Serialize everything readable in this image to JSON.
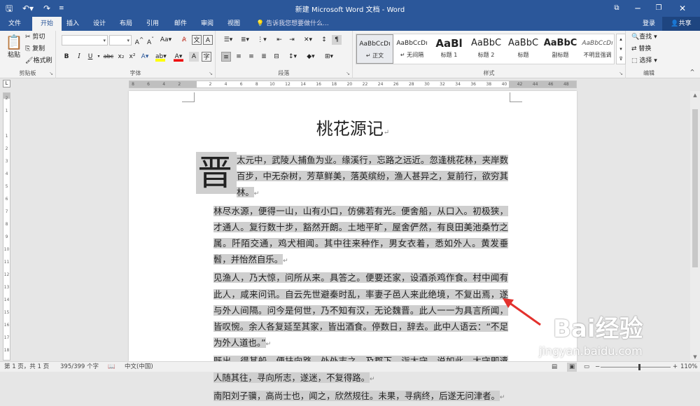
{
  "titlebar": {
    "title": "新建 Microsoft Word 文档 - Word",
    "qa_save_icon": "save-icon",
    "qa_undo_icon": "undo-icon",
    "qa_redo_icon": "redo-icon",
    "qa_customize_icon": "customize-icon"
  },
  "tabs": {
    "file": "文件",
    "home": "开始",
    "insert": "插入",
    "design": "设计",
    "layout": "布局",
    "references": "引用",
    "mailings": "邮件",
    "review": "审阅",
    "view": "视图",
    "tell": "告诉我您想要做什么...",
    "login": "登录",
    "share": "共享"
  },
  "ribbon": {
    "clipboard": {
      "paste": "粘贴",
      "cut": "剪切",
      "copy": "复制",
      "format_painter": "格式刷",
      "label": "剪贴板"
    },
    "font": {
      "label": "字体",
      "name_value": "",
      "size_value": ""
    },
    "paragraph": {
      "label": "段落"
    },
    "styles": {
      "label": "样式",
      "items": [
        {
          "preview": "AaBbCcDı",
          "name": "↵ 正文"
        },
        {
          "preview": "AaBbCcDı",
          "name": "↵ 无间隔"
        },
        {
          "preview": "AaBl",
          "name": "标题 1"
        },
        {
          "preview": "AaBbC",
          "name": "标题 2"
        },
        {
          "preview": "AaBbC",
          "name": "标题"
        },
        {
          "preview": "AaBbC",
          "name": "副标题"
        },
        {
          "preview": "AaBbCcDı",
          "name": "不明显强调"
        }
      ]
    },
    "editing": {
      "find": "查找",
      "replace": "替换",
      "select": "选择",
      "label": "编辑"
    }
  },
  "ruler": {
    "ticks": [
      "8",
      "6",
      "4",
      "2",
      "",
      "2",
      "4",
      "6",
      "8",
      "10",
      "12",
      "14",
      "16",
      "18",
      "20",
      "22",
      "24",
      "26",
      "28",
      "30",
      "32",
      "34",
      "36",
      "38",
      "40",
      "42",
      "44",
      "46",
      "48"
    ],
    "vticks": [
      "2",
      "1",
      "",
      "1",
      "2",
      "3",
      "4",
      "5",
      "6",
      "7",
      "8",
      "9",
      "10",
      "11",
      "12",
      "13",
      "14",
      "15",
      "16",
      "17",
      "18"
    ]
  },
  "document": {
    "title": "桃花源记",
    "dropcap": "晋",
    "paragraphs": [
      "太元中，武陵人捕鱼为业。缘溪行，忘路之远近。忽逢桃花林，夹岸数百步，中无杂树，芳草鲜美，落英缤纷，渔人甚异之，复前行，欲穷其林。",
      "林尽水源，便得一山，山有小口，仿佛若有光。便舍船，从口入。初极狭，才通人。复行数十步，豁然开朗。土地平旷，屋舍俨然，有良田美池桑竹之属。阡陌交通，鸡犬相闻。其中往来种作，男女衣着，悉如外人。黄发垂髫，并怡然自乐。",
      "见渔人，乃大惊，问所从来。具答之。便要还家，设酒杀鸡作食。村中闻有此人，咸来问讯。自云先世避秦时乱，率妻子邑人来此绝境，不复出焉，遂与外人间隔。问今是何世，乃不知有汉，无论魏晋。此人一一为具言所闻，皆叹惋。余人各复延至其家，皆出酒食。停数日，辞去。此中人语云：“不足为外人道也。”",
      "既出，得其船，便扶向路，处处志之。及郡下，诣太守，说如此。太守即遣人随其往，寻向所志，遂迷，不复得路。",
      "南阳刘子骥，高尚士也，闻之，欣然规往。未果，寻病终，后遂无问津者。"
    ]
  },
  "status": {
    "page": "第 1 页，共 1 页",
    "words": "395/399 个字",
    "language": "中文(中国)",
    "zoom": "110%",
    "zoom_minus": "−",
    "zoom_plus": "+"
  },
  "watermark": {
    "brand": "Bai经验",
    "url": "jingyan.baidu.com"
  }
}
